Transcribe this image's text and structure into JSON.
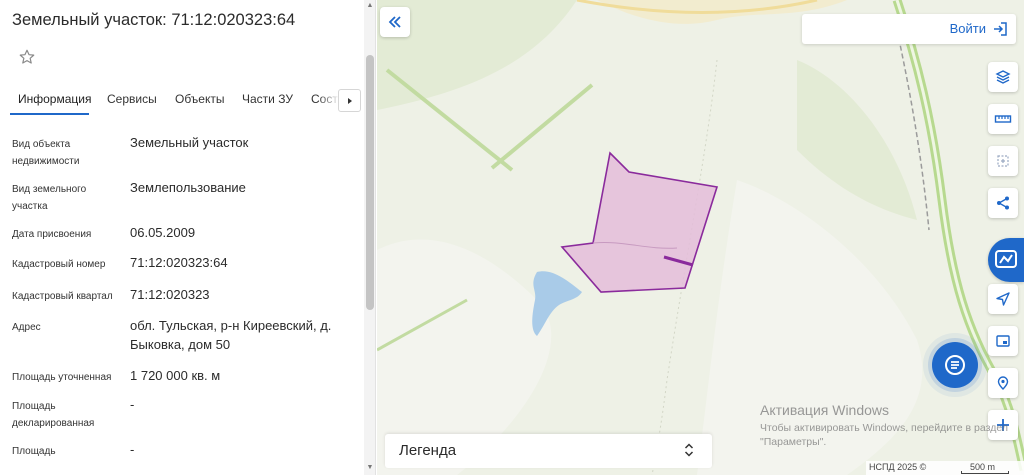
{
  "panel": {
    "title": "Земельный участок: 71:12:020323:64",
    "tabs": [
      "Информация",
      "Сервисы",
      "Объекты",
      "Части ЗУ",
      "Состав"
    ],
    "rows": [
      {
        "label": "Вид объекта недвижимости",
        "value": "Земельный участок"
      },
      {
        "label": "Вид земельного участка",
        "value": "Землепользование"
      },
      {
        "label": "Дата присвоения",
        "value": "06.05.2009"
      },
      {
        "label": "Кадастровый номер",
        "value": "71:12:020323:64"
      },
      {
        "label": "Кадастровый квартал",
        "value": "71:12:020323"
      },
      {
        "label": "Адрес",
        "value": "обл. Тульская, р-н Киреевский, д. Быковка, дом 50"
      },
      {
        "label": "Площадь уточненная",
        "value": "1 720 000 кв. м"
      },
      {
        "label": "Площадь декларированная",
        "value": "-"
      },
      {
        "label": "Площадь",
        "value": "-"
      }
    ]
  },
  "map": {
    "login_label": "Войти",
    "legend_label": "Легенда",
    "watermark_title": "Активация Windows",
    "watermark_text": "Чтобы активировать Windows, перейдите в раздел \"Параметры\".",
    "attribution": "НСПД 2025 ©",
    "scale_label": "500 m",
    "tools": [
      "layers-icon",
      "ruler-icon",
      "select-area-icon",
      "share-icon",
      "locate-icon",
      "minimap-icon",
      "geo-pin-icon",
      "zoom-in-icon"
    ],
    "colors": {
      "accent": "#1f68c9",
      "parcel_fill": "#e4bdd9",
      "parcel_stroke": "#8a2b9c",
      "water": "#a9cbe8",
      "forest": "#dfe8d0",
      "road": "#b7d98f"
    }
  }
}
